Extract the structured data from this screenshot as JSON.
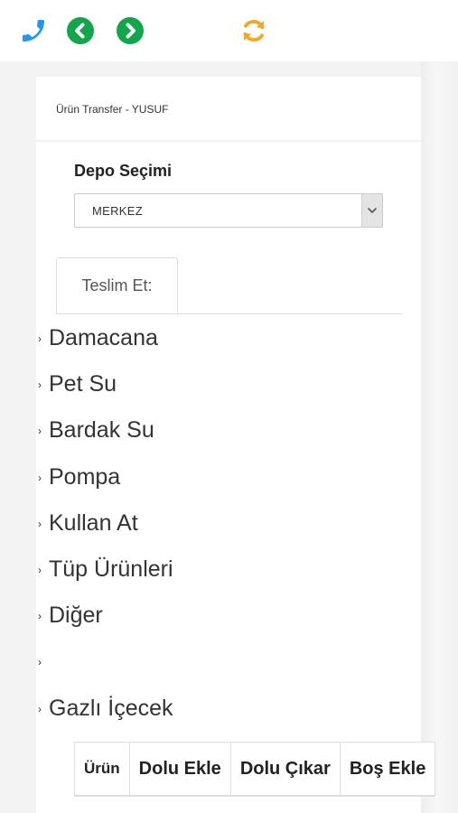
{
  "toolbar": {
    "phone_icon_color": "#2196f3",
    "nav_icon_color": "#11a64a",
    "refresh_icon_color": "#f5a623"
  },
  "header": {
    "title": "Ürün Transfer - YUSUF"
  },
  "depo": {
    "label": "Depo Seçimi",
    "selected": "MERKEZ"
  },
  "tabs": [
    {
      "label": "Teslim Et:"
    }
  ],
  "categories": [
    {
      "label": "Damacana"
    },
    {
      "label": "Pet Su"
    },
    {
      "label": "Bardak Su"
    },
    {
      "label": "Pompa"
    },
    {
      "label": "Kullan At"
    },
    {
      "label": "Tüp Ürünleri"
    },
    {
      "label": "Diğer"
    },
    {
      "label": ""
    },
    {
      "label": "Gazlı İçecek"
    }
  ],
  "table": {
    "headers": [
      "Ürün",
      "Dolu Ekle",
      "Dolu Çıkar",
      "Boş Ekle"
    ]
  }
}
